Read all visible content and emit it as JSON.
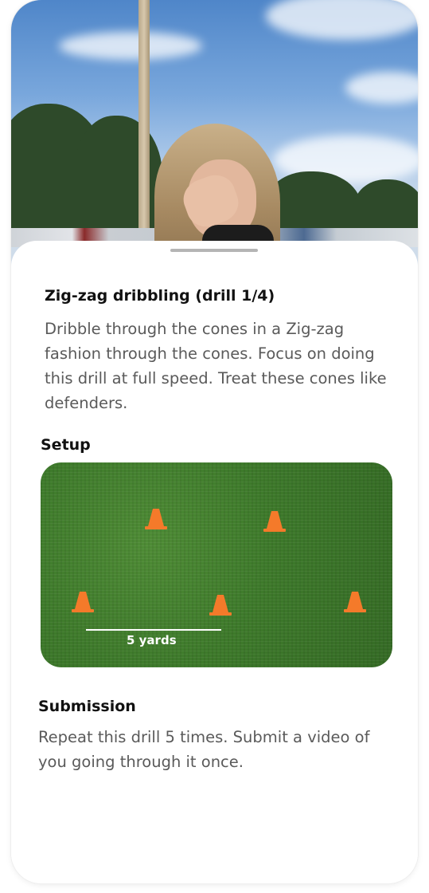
{
  "drill": {
    "title": "Zig-zag dribbling (drill 1/4)",
    "description": "Dribble through the cones in a Zig-zag fashion through the cones. Focus on doing this drill at full speed. Treat these cones like defenders."
  },
  "setup": {
    "heading": "Setup",
    "scale_label": "5 yards",
    "cone_color": "#f47a2a",
    "field_color": "#3f7a2c",
    "cone_count": 5
  },
  "submission": {
    "heading": "Submission",
    "description": "Repeat this drill 5 times. Submit a video of you going through it once."
  },
  "icons": [
    "cone-icon"
  ],
  "colors": {
    "title_text": "#111111",
    "body_text": "#5a5a5a",
    "sheet_background": "#ffffff"
  }
}
